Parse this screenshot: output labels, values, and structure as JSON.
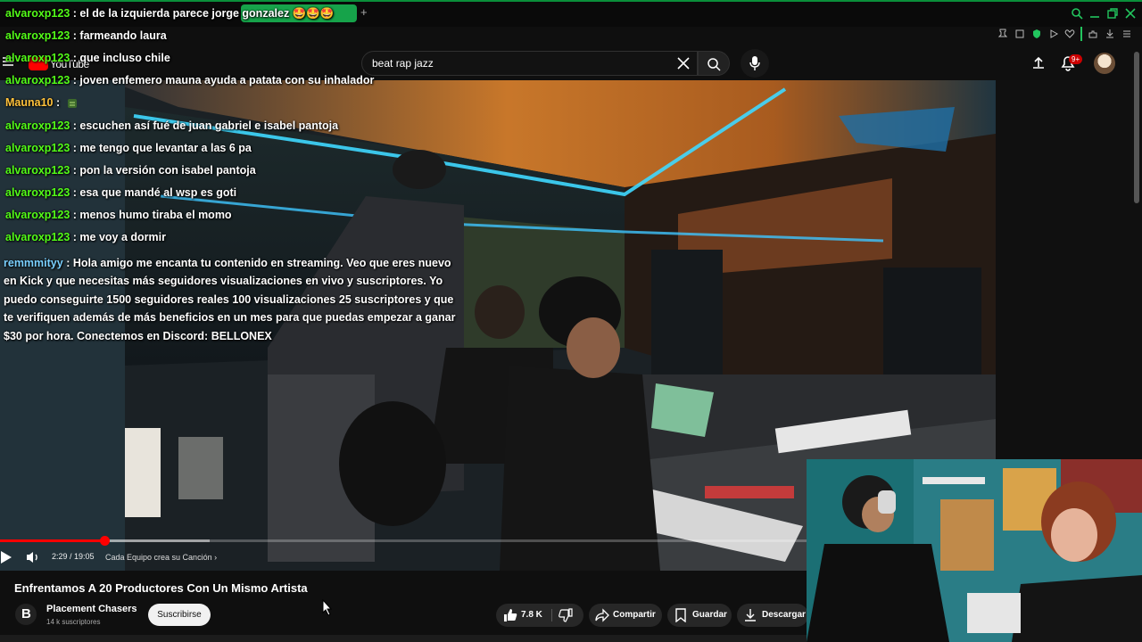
{
  "browser": {
    "window_controls": [
      "search-icon",
      "minimize-icon",
      "restore-icon",
      "close-icon"
    ],
    "toolbar_icons": [
      "pin-icon",
      "bookmark-icon",
      "shield-icon",
      "play-icon",
      "heart-icon",
      "extension-icon",
      "profile-icon",
      "download-icon",
      "menu-icon"
    ]
  },
  "youtube": {
    "logo_text": "YouTube",
    "search": {
      "value": "beat rap jazz"
    },
    "notifications_badge": "9+"
  },
  "player": {
    "time": "2:29 / 19:05",
    "chapter": "Cada Equipo crea su Canción",
    "progress_fraction": 0.13
  },
  "video": {
    "title": "Enfrentamos A 20 Productores Con Un Mismo Artista",
    "channel": "Placement Chasers",
    "channel_initial": "B",
    "subscribers": "14 k suscriptores",
    "subscribe_label": "Suscribirse",
    "likes": "7.8 K",
    "share_label": "Compartir",
    "save_label": "Guardar",
    "download_label": "Descargar"
  },
  "chat": [
    {
      "user": "alvaroxp123",
      "msg": ": el de la izquierda parece jorge gonzalez 🤩🤩🤩"
    },
    {
      "user": "alvaroxp123",
      "msg": ": farmeando laura"
    },
    {
      "user": "alvaroxp123",
      "msg": ": que incluso chile"
    },
    {
      "user": "alvaroxp123",
      "msg": ": joven enfemero mauna ayuda a patata con su inhalador"
    },
    {
      "user": "Mauna10",
      "msg": ": "
    },
    {
      "user": "alvaroxp123",
      "msg": ": escuchen así fué de juan gabriel e isabel pantoja"
    },
    {
      "user": "alvaroxp123",
      "msg": ": me tengo que levantar a las 6 pa"
    },
    {
      "user": "alvaroxp123",
      "msg": ": pon la versión con isabel pantoja"
    },
    {
      "user": "alvaroxp123",
      "msg": ": esa que mandé al wsp es goti"
    },
    {
      "user": "alvaroxp123",
      "msg": ": menos humo tiraba el momo"
    },
    {
      "user": "alvaroxp123",
      "msg": ": me voy a dormir"
    }
  ],
  "chat_long": {
    "user": "remmmityy",
    "msg": ": Hola amigo me encanta tu contenido en streaming. Veo que eres nuevo en Kick y que necesitas más seguidores visualizaciones en vivo y suscriptores. Yo puedo conseguirte 1500 seguidores reales 100 visualizaciones 25 suscriptores y que te verifiquen además de más beneficios en un mes para que puedas empezar a ganar $30 por hora. Conectemos en Discord: BELLONEX"
  },
  "colors": {
    "kick_green": "#53fc18",
    "youtube_red": "#ff0000",
    "background": "#0f0f0f"
  }
}
